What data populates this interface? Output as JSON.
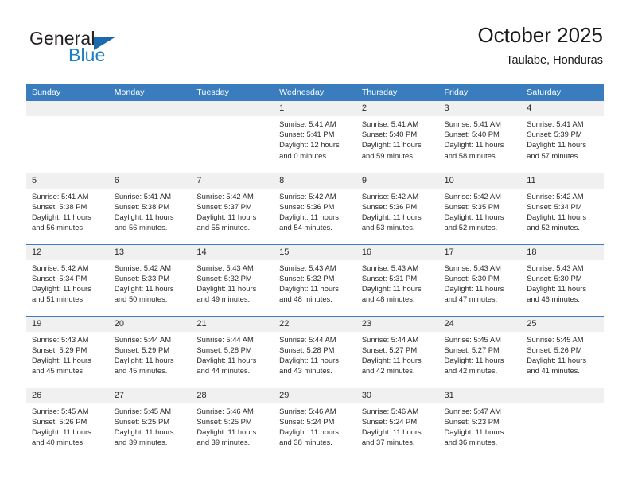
{
  "brand": {
    "name_part1": "General",
    "name_part2": "Blue",
    "logo_icon": "triangle-logo-icon",
    "colors": {
      "blue": "#1f7fc6",
      "dark_blue": "#1a6aad",
      "text": "#231f20"
    }
  },
  "header": {
    "title": "October 2025",
    "subtitle": "Taulabe, Honduras"
  },
  "theme": {
    "header_blue": "#3a7dbf",
    "daynum_bg": "#f0f0f0",
    "text": "#2b2b2b"
  },
  "weekdays": [
    "Sunday",
    "Monday",
    "Tuesday",
    "Wednesday",
    "Thursday",
    "Friday",
    "Saturday"
  ],
  "weeks": [
    [
      {
        "day": "",
        "sunrise": "",
        "sunset": "",
        "daylight": ""
      },
      {
        "day": "",
        "sunrise": "",
        "sunset": "",
        "daylight": ""
      },
      {
        "day": "",
        "sunrise": "",
        "sunset": "",
        "daylight": ""
      },
      {
        "day": "1",
        "sunrise": "Sunrise: 5:41 AM",
        "sunset": "Sunset: 5:41 PM",
        "daylight": "Daylight: 12 hours and 0 minutes."
      },
      {
        "day": "2",
        "sunrise": "Sunrise: 5:41 AM",
        "sunset": "Sunset: 5:40 PM",
        "daylight": "Daylight: 11 hours and 59 minutes."
      },
      {
        "day": "3",
        "sunrise": "Sunrise: 5:41 AM",
        "sunset": "Sunset: 5:40 PM",
        "daylight": "Daylight: 11 hours and 58 minutes."
      },
      {
        "day": "4",
        "sunrise": "Sunrise: 5:41 AM",
        "sunset": "Sunset: 5:39 PM",
        "daylight": "Daylight: 11 hours and 57 minutes."
      }
    ],
    [
      {
        "day": "5",
        "sunrise": "Sunrise: 5:41 AM",
        "sunset": "Sunset: 5:38 PM",
        "daylight": "Daylight: 11 hours and 56 minutes."
      },
      {
        "day": "6",
        "sunrise": "Sunrise: 5:41 AM",
        "sunset": "Sunset: 5:38 PM",
        "daylight": "Daylight: 11 hours and 56 minutes."
      },
      {
        "day": "7",
        "sunrise": "Sunrise: 5:42 AM",
        "sunset": "Sunset: 5:37 PM",
        "daylight": "Daylight: 11 hours and 55 minutes."
      },
      {
        "day": "8",
        "sunrise": "Sunrise: 5:42 AM",
        "sunset": "Sunset: 5:36 PM",
        "daylight": "Daylight: 11 hours and 54 minutes."
      },
      {
        "day": "9",
        "sunrise": "Sunrise: 5:42 AM",
        "sunset": "Sunset: 5:36 PM",
        "daylight": "Daylight: 11 hours and 53 minutes."
      },
      {
        "day": "10",
        "sunrise": "Sunrise: 5:42 AM",
        "sunset": "Sunset: 5:35 PM",
        "daylight": "Daylight: 11 hours and 52 minutes."
      },
      {
        "day": "11",
        "sunrise": "Sunrise: 5:42 AM",
        "sunset": "Sunset: 5:34 PM",
        "daylight": "Daylight: 11 hours and 52 minutes."
      }
    ],
    [
      {
        "day": "12",
        "sunrise": "Sunrise: 5:42 AM",
        "sunset": "Sunset: 5:34 PM",
        "daylight": "Daylight: 11 hours and 51 minutes."
      },
      {
        "day": "13",
        "sunrise": "Sunrise: 5:42 AM",
        "sunset": "Sunset: 5:33 PM",
        "daylight": "Daylight: 11 hours and 50 minutes."
      },
      {
        "day": "14",
        "sunrise": "Sunrise: 5:43 AM",
        "sunset": "Sunset: 5:32 PM",
        "daylight": "Daylight: 11 hours and 49 minutes."
      },
      {
        "day": "15",
        "sunrise": "Sunrise: 5:43 AM",
        "sunset": "Sunset: 5:32 PM",
        "daylight": "Daylight: 11 hours and 48 minutes."
      },
      {
        "day": "16",
        "sunrise": "Sunrise: 5:43 AM",
        "sunset": "Sunset: 5:31 PM",
        "daylight": "Daylight: 11 hours and 48 minutes."
      },
      {
        "day": "17",
        "sunrise": "Sunrise: 5:43 AM",
        "sunset": "Sunset: 5:30 PM",
        "daylight": "Daylight: 11 hours and 47 minutes."
      },
      {
        "day": "18",
        "sunrise": "Sunrise: 5:43 AM",
        "sunset": "Sunset: 5:30 PM",
        "daylight": "Daylight: 11 hours and 46 minutes."
      }
    ],
    [
      {
        "day": "19",
        "sunrise": "Sunrise: 5:43 AM",
        "sunset": "Sunset: 5:29 PM",
        "daylight": "Daylight: 11 hours and 45 minutes."
      },
      {
        "day": "20",
        "sunrise": "Sunrise: 5:44 AM",
        "sunset": "Sunset: 5:29 PM",
        "daylight": "Daylight: 11 hours and 45 minutes."
      },
      {
        "day": "21",
        "sunrise": "Sunrise: 5:44 AM",
        "sunset": "Sunset: 5:28 PM",
        "daylight": "Daylight: 11 hours and 44 minutes."
      },
      {
        "day": "22",
        "sunrise": "Sunrise: 5:44 AM",
        "sunset": "Sunset: 5:28 PM",
        "daylight": "Daylight: 11 hours and 43 minutes."
      },
      {
        "day": "23",
        "sunrise": "Sunrise: 5:44 AM",
        "sunset": "Sunset: 5:27 PM",
        "daylight": "Daylight: 11 hours and 42 minutes."
      },
      {
        "day": "24",
        "sunrise": "Sunrise: 5:45 AM",
        "sunset": "Sunset: 5:27 PM",
        "daylight": "Daylight: 11 hours and 42 minutes."
      },
      {
        "day": "25",
        "sunrise": "Sunrise: 5:45 AM",
        "sunset": "Sunset: 5:26 PM",
        "daylight": "Daylight: 11 hours and 41 minutes."
      }
    ],
    [
      {
        "day": "26",
        "sunrise": "Sunrise: 5:45 AM",
        "sunset": "Sunset: 5:26 PM",
        "daylight": "Daylight: 11 hours and 40 minutes."
      },
      {
        "day": "27",
        "sunrise": "Sunrise: 5:45 AM",
        "sunset": "Sunset: 5:25 PM",
        "daylight": "Daylight: 11 hours and 39 minutes."
      },
      {
        "day": "28",
        "sunrise": "Sunrise: 5:46 AM",
        "sunset": "Sunset: 5:25 PM",
        "daylight": "Daylight: 11 hours and 39 minutes."
      },
      {
        "day": "29",
        "sunrise": "Sunrise: 5:46 AM",
        "sunset": "Sunset: 5:24 PM",
        "daylight": "Daylight: 11 hours and 38 minutes."
      },
      {
        "day": "30",
        "sunrise": "Sunrise: 5:46 AM",
        "sunset": "Sunset: 5:24 PM",
        "daylight": "Daylight: 11 hours and 37 minutes."
      },
      {
        "day": "31",
        "sunrise": "Sunrise: 5:47 AM",
        "sunset": "Sunset: 5:23 PM",
        "daylight": "Daylight: 11 hours and 36 minutes."
      },
      {
        "day": "",
        "sunrise": "",
        "sunset": "",
        "daylight": ""
      }
    ]
  ]
}
